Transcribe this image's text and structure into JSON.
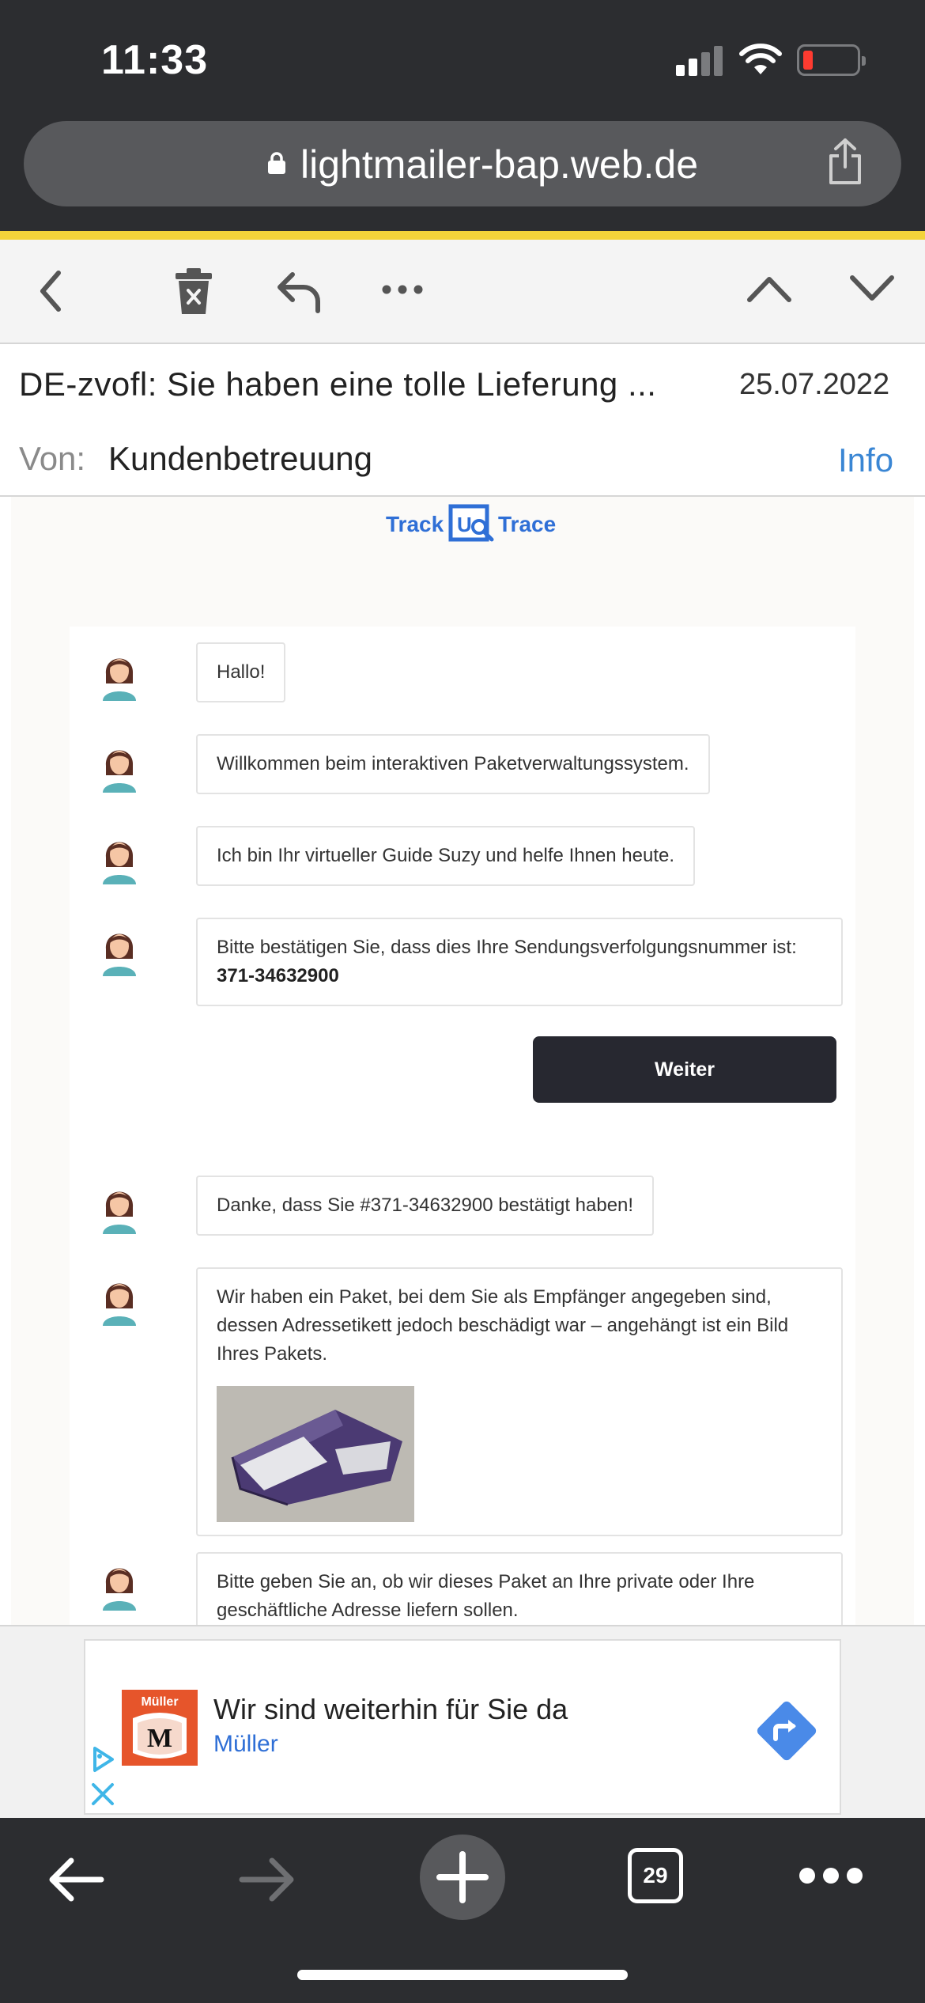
{
  "status_bar": {
    "time": "11:33"
  },
  "browser": {
    "url": "lightmailer-bap.web.de"
  },
  "mail": {
    "subject": "DE-zvofl: Sie haben eine tolle Lieferung ...",
    "date": "25.07.2022",
    "from_label": "Von:",
    "from_value": "Kundenbetreuung",
    "info_link": "Info"
  },
  "email": {
    "logo": {
      "left": "Track",
      "right": "Trace",
      "badge": "U"
    },
    "messages": [
      {
        "text": "Hallo!"
      },
      {
        "text": "Willkommen beim interaktiven Paketverwaltungssystem."
      },
      {
        "text": "Ich bin Ihr virtueller Guide Suzy und helfe Ihnen heute."
      },
      {
        "text": "Bitte bestätigen Sie, dass dies Ihre Sendungsverfolgungsnummer ist:",
        "bold": "371-34632900"
      },
      {
        "text": "Danke, dass Sie #371-34632900 bestätigt haben!"
      },
      {
        "text": "Wir haben ein Paket, bei dem Sie als Empfänger angegeben sind, dessen Adressetikett jedoch beschädigt war – angehängt ist ein Bild Ihres Pakets."
      },
      {
        "text": "Bitte geben Sie an, ob wir dieses Paket an Ihre private oder Ihre geschäftliche Adresse liefern sollen."
      }
    ],
    "continue_button": "Weiter"
  },
  "ad": {
    "logo_text": "Müller",
    "logo_letter": "M",
    "title": "Wir sind weiterhin für Sie da",
    "advertiser": "Müller"
  },
  "bottom_bar": {
    "tab_count": "29"
  },
  "colors": {
    "accent": "#f3d33a",
    "link": "#3a86d4",
    "dark": "#2c2d30",
    "button": "#272830"
  }
}
